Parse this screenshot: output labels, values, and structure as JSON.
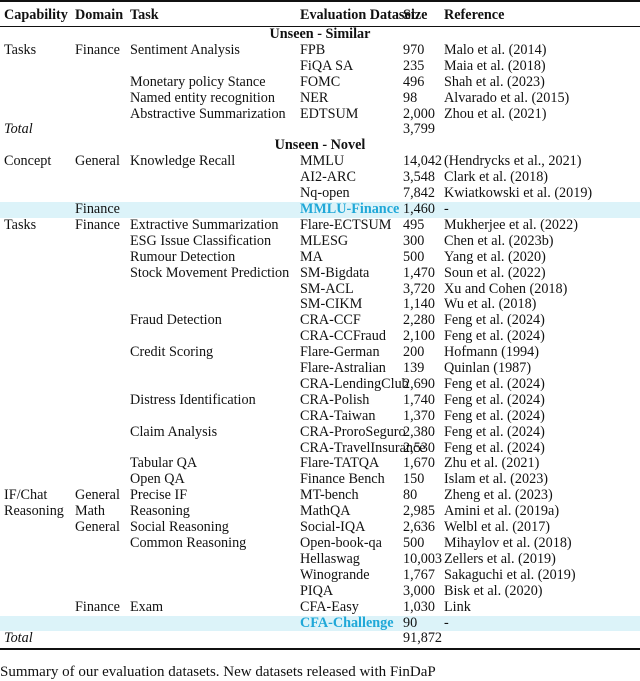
{
  "table": {
    "headers": [
      "Capability",
      "Domain",
      "Task",
      "Evaluation Dataset",
      "Size",
      "Reference"
    ],
    "sections": [
      {
        "title": "Unseen - Similar",
        "rows": [
          {
            "capability": "Tasks",
            "domain": "Finance",
            "task": "Sentiment Analysis",
            "dataset": "FPB",
            "size": "970",
            "reference": "Malo et al. (2014)"
          },
          {
            "capability": "",
            "domain": "",
            "task": "",
            "dataset": "FiQA SA",
            "size": "235",
            "reference": "Maia et al. (2018)"
          },
          {
            "capability": "",
            "domain": "",
            "task": "Monetary policy Stance",
            "dataset": "FOMC",
            "size": "496",
            "reference": "Shah et al. (2023)"
          },
          {
            "capability": "",
            "domain": "",
            "task": "Named entity recognition",
            "dataset": "NER",
            "size": "98",
            "reference": "Alvarado et al. (2015)"
          },
          {
            "capability": "",
            "domain": "",
            "task": "Abstractive Summarization",
            "dataset": "EDTSUM",
            "size": "2,000",
            "reference": "Zhou et al. (2021)"
          }
        ],
        "total": {
          "label": "Total",
          "size": "3,799"
        }
      },
      {
        "title": "Unseen - Novel",
        "rows": [
          {
            "capability": "Concept",
            "domain": "General",
            "task": "Knowledge Recall",
            "dataset": "MMLU",
            "size": "14,042",
            "reference": "(Hendrycks et al., 2021)"
          },
          {
            "capability": "",
            "domain": "",
            "task": "",
            "dataset": "AI2-ARC",
            "size": "3,548",
            "reference": "Clark et al. (2018)"
          },
          {
            "capability": "",
            "domain": "",
            "task": "",
            "dataset": "Nq-open",
            "size": "7,842",
            "reference": "Kwiatkowski et al. (2019)"
          },
          {
            "capability": "",
            "domain": "Finance",
            "task": "",
            "dataset": "MMLU-Finance",
            "size": "1,460",
            "reference": "-",
            "highlight": true
          },
          {
            "capability": "Tasks",
            "domain": "Finance",
            "task": "Extractive Summarization",
            "dataset": "Flare-ECTSUM",
            "size": "495",
            "reference": "Mukherjee et al. (2022)"
          },
          {
            "capability": "",
            "domain": "",
            "task": "ESG Issue Classification",
            "dataset": "MLESG",
            "size": "300",
            "reference": "Chen et al. (2023b)"
          },
          {
            "capability": "",
            "domain": "",
            "task": "Rumour Detection",
            "dataset": "MA",
            "size": "500",
            "reference": "Yang et al. (2020)"
          },
          {
            "capability": "",
            "domain": "",
            "task": "Stock Movement Prediction",
            "dataset": "SM-Bigdata",
            "size": "1,470",
            "reference": "Soun et al. (2022)"
          },
          {
            "capability": "",
            "domain": "",
            "task": "",
            "dataset": "SM-ACL",
            "size": "3,720",
            "reference": "Xu and Cohen (2018)"
          },
          {
            "capability": "",
            "domain": "",
            "task": "",
            "dataset": "SM-CIKM",
            "size": "1,140",
            "reference": "Wu et al. (2018)"
          },
          {
            "capability": "",
            "domain": "",
            "task": "Fraud Detection",
            "dataset": "CRA-CCF",
            "size": "2,280",
            "reference": "Feng et al. (2024)"
          },
          {
            "capability": "",
            "domain": "",
            "task": "",
            "dataset": "CRA-CCFraud",
            "size": "2,100",
            "reference": "Feng et al. (2024)"
          },
          {
            "capability": "",
            "domain": "",
            "task": "Credit Scoring",
            "dataset": "Flare-German",
            "size": "200",
            "reference": "Hofmann (1994)"
          },
          {
            "capability": "",
            "domain": "",
            "task": "",
            "dataset": "Flare-Astralian",
            "size": "139",
            "reference": "Quinlan (1987)"
          },
          {
            "capability": "",
            "domain": "",
            "task": "",
            "dataset": "CRA-LendingClub",
            "size": "2,690",
            "reference": "Feng et al. (2024)"
          },
          {
            "capability": "",
            "domain": "",
            "task": "Distress Identification",
            "dataset": "CRA-Polish",
            "size": "1,740",
            "reference": "Feng et al. (2024)"
          },
          {
            "capability": "",
            "domain": "",
            "task": "",
            "dataset": "CRA-Taiwan",
            "size": "1,370",
            "reference": "Feng et al. (2024)"
          },
          {
            "capability": "",
            "domain": "",
            "task": "Claim Analysis",
            "dataset": "CRA-ProroSeguro",
            "size": "2,380",
            "reference": "Feng et al. (2024)"
          },
          {
            "capability": "",
            "domain": "",
            "task": "",
            "dataset": "CRA-TravelInsurance",
            "size": "2,530",
            "reference": "Feng et al. (2024)"
          },
          {
            "capability": "",
            "domain": "",
            "task": "Tabular QA",
            "dataset": "Flare-TATQA",
            "size": "1,670",
            "reference": "Zhu et al. (2021)"
          },
          {
            "capability": "",
            "domain": "",
            "task": "Open QA",
            "dataset": "Finance Bench",
            "size": "150",
            "reference": "Islam et al. (2023)"
          },
          {
            "capability": "IF/Chat",
            "domain": "General",
            "task": "Precise IF",
            "dataset": "MT-bench",
            "size": "80",
            "reference": "Zheng et al. (2023)"
          },
          {
            "capability": "Reasoning",
            "domain": "Math",
            "task": "Reasoning",
            "dataset": "MathQA",
            "size": "2,985",
            "reference": "Amini et al. (2019a)"
          },
          {
            "capability": "",
            "domain": "General",
            "task": "Social Reasoning",
            "dataset": "Social-IQA",
            "size": "2,636",
            "reference": "Welbl et al. (2017)"
          },
          {
            "capability": "",
            "domain": "",
            "task": "Common Reasoning",
            "dataset": "Open-book-qa",
            "size": "500",
            "reference": "Mihaylov et al. (2018)"
          },
          {
            "capability": "",
            "domain": "",
            "task": "",
            "dataset": "Hellaswag",
            "size": "10,003",
            "reference": "Zellers et al. (2019)"
          },
          {
            "capability": "",
            "domain": "",
            "task": "",
            "dataset": "Winogrande",
            "size": "1,767",
            "reference": "Sakaguchi et al. (2019)"
          },
          {
            "capability": "",
            "domain": "",
            "task": "",
            "dataset": "PIQA",
            "size": "3,000",
            "reference": "Bisk et al. (2020)"
          },
          {
            "capability": "",
            "domain": "Finance",
            "task": "Exam",
            "dataset": "CFA-Easy",
            "size": "1,030",
            "reference": "Link"
          },
          {
            "capability": "",
            "domain": "",
            "task": "",
            "dataset": "CFA-Challenge",
            "size": "90",
            "reference": "-",
            "highlight": true
          }
        ],
        "total": {
          "label": "Total",
          "size": "91,872"
        }
      }
    ],
    "highlight_colors": {
      "row_background": "#dcf3f9",
      "dataset_text": "#20a8d8"
    }
  },
  "caption": "Summary of our evaluation datasets. New datasets released with FinDaP"
}
